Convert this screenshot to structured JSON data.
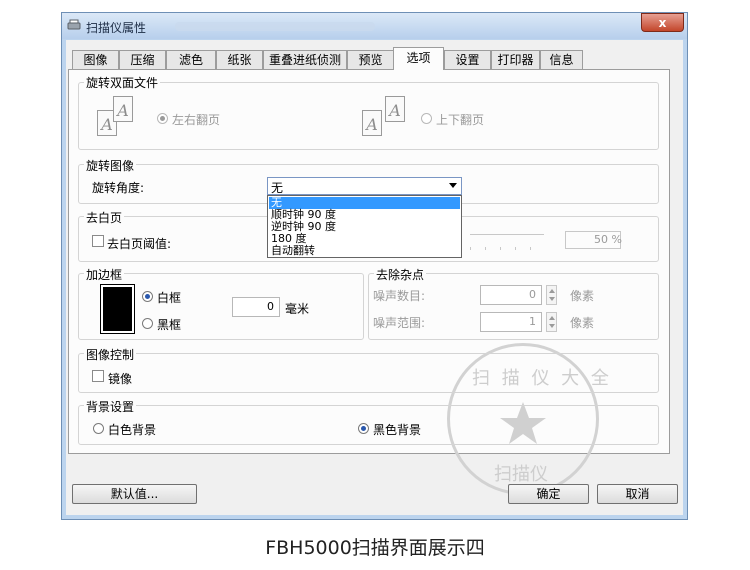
{
  "window": {
    "title": "扫描仪属性",
    "close_label": "x"
  },
  "tabs": [
    {
      "label": "图像"
    },
    {
      "label": "压缩"
    },
    {
      "label": "滤色"
    },
    {
      "label": "纸张"
    },
    {
      "label": "重叠进纸侦测"
    },
    {
      "label": "预览"
    },
    {
      "label": "选项"
    },
    {
      "label": "设置"
    },
    {
      "label": "打印器"
    },
    {
      "label": "信息"
    }
  ],
  "active_tab": "选项",
  "rotate_duplex": {
    "title": "旋转双面文件",
    "option1": "左右翻页",
    "option1_selected": true,
    "option2": "上下翻页",
    "option2_selected": false
  },
  "rotate_image": {
    "title": "旋转图像",
    "angle_label": "旋转角度:",
    "selected": "无",
    "options": [
      "无",
      "顺时钟 90 度",
      "逆时钟 90 度",
      "180 度",
      "自动翻转"
    ]
  },
  "blank_page": {
    "title": "去白页",
    "threshold_label": "去白页阈值:",
    "threshold_checked": false,
    "value": "50 %"
  },
  "border": {
    "title": "加边框",
    "white_label": "白框",
    "white_selected": true,
    "black_label": "黑框",
    "black_selected": false,
    "width_value": "0",
    "unit": "毫米"
  },
  "noise": {
    "title": "去除杂点",
    "count_label": "噪声数目:",
    "count_value": "0",
    "count_unit": "像素",
    "range_label": "噪声范围:",
    "range_value": "1",
    "range_unit": "像素"
  },
  "image_control": {
    "title": "图像控制",
    "mirror_label": "镜像",
    "mirror_checked": false
  },
  "background": {
    "title": "背景设置",
    "white_label": "白色背景",
    "white_selected": false,
    "black_label": "黑色背景",
    "black_selected": true
  },
  "buttons": {
    "default": "默认值...",
    "ok": "确定",
    "cancel": "取消"
  },
  "watermark": {
    "top_text": "扫 描 仪 大 全",
    "bottom_text": "扫描仪"
  },
  "caption": "FBH5000扫描界面展示四",
  "colors": {
    "selection": "#3399ff",
    "radio_dot": "#2a58ad"
  }
}
